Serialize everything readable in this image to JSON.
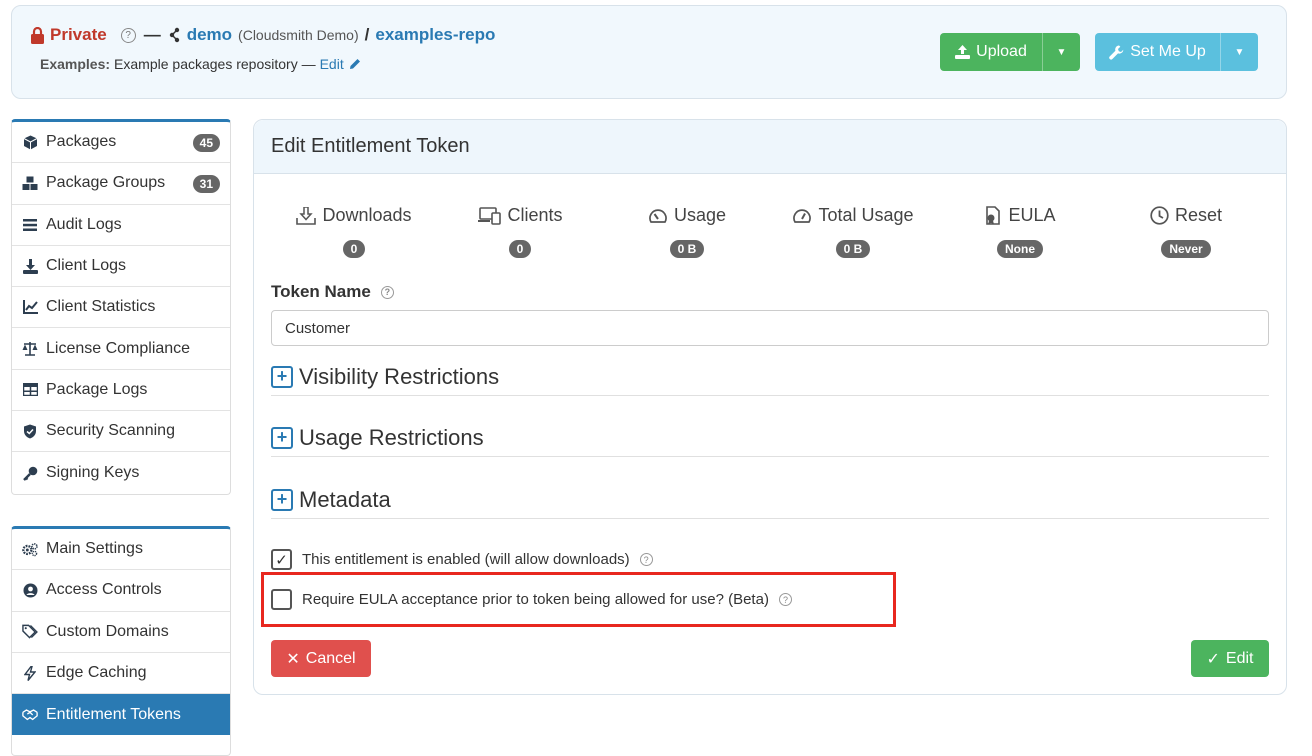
{
  "header": {
    "visibility": "Private",
    "owner": "demo",
    "owner_full": "(Cloudsmith Demo)",
    "separator": "/",
    "repo": "examples-repo",
    "desc_label": "Examples:",
    "desc_text": "Example packages repository —",
    "edit_label": "Edit",
    "upload_label": "Upload",
    "setmeup_label": "Set Me Up"
  },
  "sidebar": {
    "group1": [
      {
        "label": "Packages",
        "badge": "45",
        "icon": "box-icon"
      },
      {
        "label": "Package Groups",
        "badge": "31",
        "icon": "boxes-icon"
      },
      {
        "label": "Audit Logs",
        "icon": "list-icon"
      },
      {
        "label": "Client Logs",
        "icon": "download-icon"
      },
      {
        "label": "Client Statistics",
        "icon": "chart-icon"
      },
      {
        "label": "License Compliance",
        "icon": "scale-icon"
      },
      {
        "label": "Package Logs",
        "icon": "table-icon"
      },
      {
        "label": "Security Scanning",
        "icon": "shield-icon"
      },
      {
        "label": "Signing Keys",
        "icon": "key-icon"
      }
    ],
    "group2": [
      {
        "label": "Main Settings",
        "icon": "gears-icon"
      },
      {
        "label": "Access Controls",
        "icon": "user-icon"
      },
      {
        "label": "Custom Domains",
        "icon": "tags-icon"
      },
      {
        "label": "Edge Caching",
        "icon": "bolt-icon"
      },
      {
        "label": "Entitlement Tokens",
        "icon": "handshake-icon"
      }
    ]
  },
  "panel": {
    "title": "Edit Entitlement Token",
    "stats": [
      {
        "label": "Downloads",
        "value": "0"
      },
      {
        "label": "Clients",
        "value": "0"
      },
      {
        "label": "Usage",
        "value": "0 B"
      },
      {
        "label": "Total Usage",
        "value": "0 B"
      },
      {
        "label": "EULA",
        "value": "None"
      },
      {
        "label": "Reset",
        "value": "Never"
      }
    ],
    "token_name_label": "Token Name",
    "token_name_value": "Customer",
    "sections": [
      "Visibility Restrictions",
      "Usage Restrictions",
      "Metadata"
    ],
    "enabled_label": "This entitlement is enabled (will allow downloads)",
    "eula_label": "Require EULA acceptance prior to token being allowed for use? (Beta)",
    "cancel_label": "Cancel",
    "edit_label": "Edit"
  }
}
